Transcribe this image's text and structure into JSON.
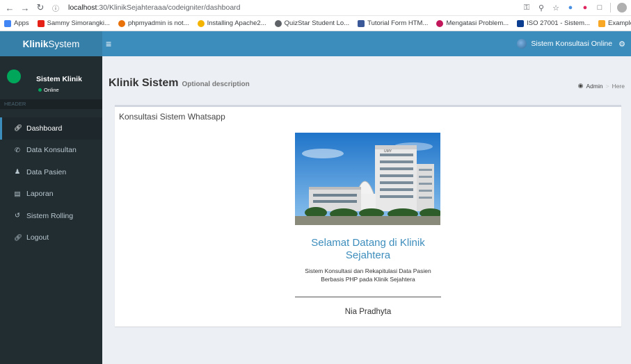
{
  "browser": {
    "url_info_icon": "info-icon",
    "url_host": "localhost",
    "url_path": ":30/KlinikSejahteraaa/codeigniter/dashboard",
    "bookmarks": [
      {
        "label": "Apps",
        "color": "#4285f4"
      },
      {
        "label": "Sammy Simorangki...",
        "color": "#e62117"
      },
      {
        "label": "phpmyadmin is not...",
        "color": "#e8710a"
      },
      {
        "label": "Installing Apache2...",
        "color": "#f4b400"
      },
      {
        "label": "QuizStar Student Lo...",
        "color": "#5f6368"
      },
      {
        "label": "Tutorial Form HTM...",
        "color": "#3b5998"
      },
      {
        "label": "Mengatasi Problem...",
        "color": "#c2185b"
      },
      {
        "label": "ISO 27001 - Sistem...",
        "color": "#0b3d91"
      },
      {
        "label": "Examples of the Mo...",
        "color": "#f9a825"
      }
    ]
  },
  "header": {
    "logo_bold": "Klinik",
    "logo_rest": "System",
    "user_label": "Sistem Konsultasi Online",
    "brand_color": "#3c8dbc"
  },
  "sidebar": {
    "user_name": "Sistem Klinik",
    "user_status": "Online",
    "section_header": "HEADER",
    "items": [
      {
        "label": "Dashboard",
        "icon": "link-icon",
        "active": true
      },
      {
        "label": "Data Konsultan",
        "icon": "phone-icon",
        "active": false
      },
      {
        "label": "Data Pasien",
        "icon": "user-icon",
        "active": false
      },
      {
        "label": "Laporan",
        "icon": "book-icon",
        "active": false
      },
      {
        "label": "Sistem Rolling",
        "icon": "history-icon",
        "active": false
      },
      {
        "label": "Logout",
        "icon": "link-icon",
        "active": false
      }
    ]
  },
  "content": {
    "title": "Klinik Sistem",
    "subtitle": "Optional description",
    "breadcrumb_home": "Admin",
    "breadcrumb_here": "Here",
    "box_title": "Konsultasi Sistem Whatsapp",
    "welcome_line1": "Selamat Datang di Klinik",
    "welcome_line2": "Sejahtera",
    "desc_line1": "Sistem Konsultasi dan Rekapitulasi Data Pasien",
    "desc_line2": "Berbasis PHP pada Klinik Sejahtera",
    "author": "Nia Pradhyta",
    "building_sign": "UMY"
  }
}
